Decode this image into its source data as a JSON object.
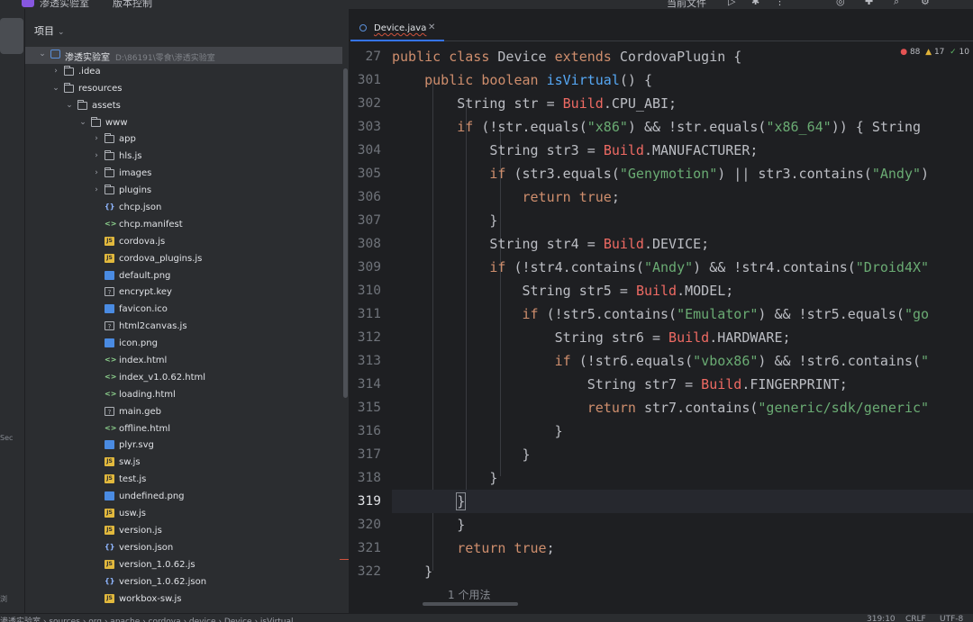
{
  "topbar": {
    "project_name": "渗透实验室",
    "vcs_label": "版本控制",
    "run_config": "当前文件"
  },
  "sidebar": {
    "labels": [
      "Sec",
      "浏"
    ]
  },
  "project_panel": {
    "title": "项目",
    "tree": [
      {
        "name": "渗透实验室",
        "path": "D:\\86191\\零食\\渗透实验室",
        "type": "module",
        "depth": 0,
        "expanded": true,
        "selected": true
      },
      {
        "name": ".idea",
        "type": "folder",
        "depth": 1,
        "expanded": false
      },
      {
        "name": "resources",
        "type": "folder",
        "depth": 1,
        "expanded": true
      },
      {
        "name": "assets",
        "type": "folder",
        "depth": 2,
        "expanded": true
      },
      {
        "name": "www",
        "type": "folder",
        "depth": 3,
        "expanded": true
      },
      {
        "name": "app",
        "type": "folder",
        "depth": 4,
        "expanded": false
      },
      {
        "name": "hls.js",
        "type": "folder",
        "depth": 4,
        "expanded": false
      },
      {
        "name": "images",
        "type": "folder",
        "depth": 4,
        "expanded": false
      },
      {
        "name": "plugins",
        "type": "folder",
        "depth": 4,
        "expanded": false
      },
      {
        "name": "chcp.json",
        "type": "json",
        "depth": 4
      },
      {
        "name": "chcp.manifest",
        "type": "html",
        "depth": 4
      },
      {
        "name": "cordova.js",
        "type": "js",
        "depth": 4
      },
      {
        "name": "cordova_plugins.js",
        "type": "js",
        "depth": 4
      },
      {
        "name": "default.png",
        "type": "png",
        "depth": 4
      },
      {
        "name": "encrypt.key",
        "type": "gen",
        "depth": 4
      },
      {
        "name": "favicon.ico",
        "type": "png",
        "depth": 4
      },
      {
        "name": "html2canvas.js",
        "type": "gen",
        "depth": 4
      },
      {
        "name": "icon.png",
        "type": "png",
        "depth": 4
      },
      {
        "name": "index.html",
        "type": "html",
        "depth": 4
      },
      {
        "name": "index_v1.0.62.html",
        "type": "html",
        "depth": 4
      },
      {
        "name": "loading.html",
        "type": "html",
        "depth": 4
      },
      {
        "name": "main.geb",
        "type": "gen",
        "depth": 4
      },
      {
        "name": "offline.html",
        "type": "html",
        "depth": 4
      },
      {
        "name": "plyr.svg",
        "type": "png",
        "depth": 4
      },
      {
        "name": "sw.js",
        "type": "js",
        "depth": 4
      },
      {
        "name": "test.js",
        "type": "js",
        "depth": 4
      },
      {
        "name": "undefined.png",
        "type": "png",
        "depth": 4
      },
      {
        "name": "usw.js",
        "type": "js",
        "depth": 4
      },
      {
        "name": "version.js",
        "type": "js",
        "depth": 4
      },
      {
        "name": "version.json",
        "type": "json",
        "depth": 4
      },
      {
        "name": "version_1.0.62.js",
        "type": "js",
        "depth": 4
      },
      {
        "name": "version_1.0.62.json",
        "type": "json",
        "depth": 4
      },
      {
        "name": "workbox-sw.js",
        "type": "js",
        "depth": 4
      }
    ]
  },
  "editor": {
    "tab_label": "Device.java",
    "inspections": {
      "errors": "88",
      "warnings": "17",
      "ok": "10"
    },
    "current_line": "319",
    "usages_hint": "1 个用法",
    "lines": [
      {
        "num": "27",
        "tokens": [
          [
            "kw",
            "public class "
          ],
          [
            "",
            "Device "
          ],
          [
            "kw",
            "extends "
          ],
          [
            "",
            "CordovaPlugin {"
          ]
        ]
      },
      {
        "num": "301",
        "tokens": [
          [
            "",
            "    "
          ],
          [
            "kw",
            "public boolean "
          ],
          [
            "fn",
            "isVirtual"
          ],
          [
            "",
            "() {"
          ]
        ]
      },
      {
        "num": "302",
        "tokens": [
          [
            "",
            "        String str = "
          ],
          [
            "cls",
            "Build"
          ],
          [
            "",
            ".CPU_ABI;"
          ]
        ]
      },
      {
        "num": "303",
        "tokens": [
          [
            "",
            "        "
          ],
          [
            "kw",
            "if "
          ],
          [
            "",
            "(!str.equals("
          ],
          [
            "str",
            "\"x86\""
          ],
          [
            "",
            " ) && !str.equals("
          ],
          [
            "str",
            "\"x86_64\""
          ],
          [
            "",
            "))"
          ],
          [
            "",
            " { String"
          ]
        ]
      },
      {
        "num": "304",
        "tokens": [
          [
            "",
            "            String str3 = "
          ],
          [
            "cls",
            "Build"
          ],
          [
            "",
            ".MANUFACTURER;"
          ]
        ]
      },
      {
        "num": "305",
        "tokens": [
          [
            "",
            "            "
          ],
          [
            "kw",
            "if "
          ],
          [
            "",
            "(str3.equals("
          ],
          [
            "str",
            "\"Genymotion\""
          ],
          [
            "",
            ") || str3.contains("
          ],
          [
            "str",
            "\"Andy\""
          ],
          [
            "",
            ")"
          ]
        ]
      },
      {
        "num": "306",
        "tokens": [
          [
            "",
            "                "
          ],
          [
            "kw",
            "return true"
          ],
          [
            "",
            ";"
          ]
        ]
      },
      {
        "num": "307",
        "tokens": [
          [
            "",
            "            }"
          ]
        ]
      },
      {
        "num": "308",
        "tokens": [
          [
            "",
            "            String str4 = "
          ],
          [
            "cls",
            "Build"
          ],
          [
            "",
            ".DEVICE;"
          ]
        ]
      },
      {
        "num": "309",
        "tokens": [
          [
            "",
            "            "
          ],
          [
            "kw",
            "if "
          ],
          [
            "",
            "(!str4.contains("
          ],
          [
            "str",
            "\"Andy\""
          ],
          [
            "",
            ") && !str4.contains("
          ],
          [
            "str",
            "\"Droid4X\""
          ]
        ]
      },
      {
        "num": "310",
        "tokens": [
          [
            "",
            "                String str5 = "
          ],
          [
            "cls",
            "Build"
          ],
          [
            "",
            ".MODEL;"
          ]
        ]
      },
      {
        "num": "311",
        "tokens": [
          [
            "",
            "                "
          ],
          [
            "kw",
            "if "
          ],
          [
            "",
            "(!str5.contains("
          ],
          [
            "str",
            "\"Emulator\""
          ],
          [
            "",
            ") && !str5.equals("
          ],
          [
            "str",
            "\"go"
          ]
        ]
      },
      {
        "num": "312",
        "tokens": [
          [
            "",
            "                    String str6 = "
          ],
          [
            "cls",
            "Build"
          ],
          [
            "",
            ".HARDWARE;"
          ]
        ]
      },
      {
        "num": "313",
        "tokens": [
          [
            "",
            "                    "
          ],
          [
            "kw",
            "if "
          ],
          [
            "",
            "(!str6.equals("
          ],
          [
            "str",
            "\"vbox86\""
          ],
          [
            "",
            ") && !str6.contains("
          ],
          [
            "str",
            "\""
          ]
        ]
      },
      {
        "num": "314",
        "tokens": [
          [
            "",
            "                        String str7 = "
          ],
          [
            "cls",
            "Build"
          ],
          [
            "",
            ".FINGERPRINT;"
          ]
        ]
      },
      {
        "num": "315",
        "tokens": [
          [
            "",
            "                        "
          ],
          [
            "kw",
            "return "
          ],
          [
            "",
            "str7.contains("
          ],
          [
            "str",
            "\"generic/sdk/generic\""
          ]
        ]
      },
      {
        "num": "316",
        "tokens": [
          [
            "",
            "                    }"
          ]
        ]
      },
      {
        "num": "317",
        "tokens": [
          [
            "",
            "                }"
          ]
        ]
      },
      {
        "num": "318",
        "tokens": [
          [
            "",
            "            }"
          ]
        ]
      },
      {
        "num": "319",
        "tokens": [
          [
            "",
            "        "
          ],
          [
            "hl",
            "}"
          ]
        ]
      },
      {
        "num": "320",
        "tokens": [
          [
            "",
            "        }"
          ]
        ]
      },
      {
        "num": "321",
        "tokens": [
          [
            "",
            "        "
          ],
          [
            "kw",
            "return true"
          ],
          [
            "",
            ";"
          ]
        ]
      },
      {
        "num": "322",
        "tokens": [
          [
            "",
            "    }"
          ]
        ]
      }
    ]
  },
  "statusbar": {
    "breadcrumb": [
      "渗透实验室",
      "sources",
      "org",
      "apache",
      "cordova",
      "device",
      "Device",
      "isVirtual"
    ],
    "position": "319:10",
    "line_sep": "CRLF",
    "encoding": "UTF-8"
  },
  "colors": {
    "keyword": "#cf8e6d",
    "function": "#56a8f5",
    "string": "#6aab73",
    "class_ref": "#ee6a63",
    "accent": "#3574f0"
  }
}
